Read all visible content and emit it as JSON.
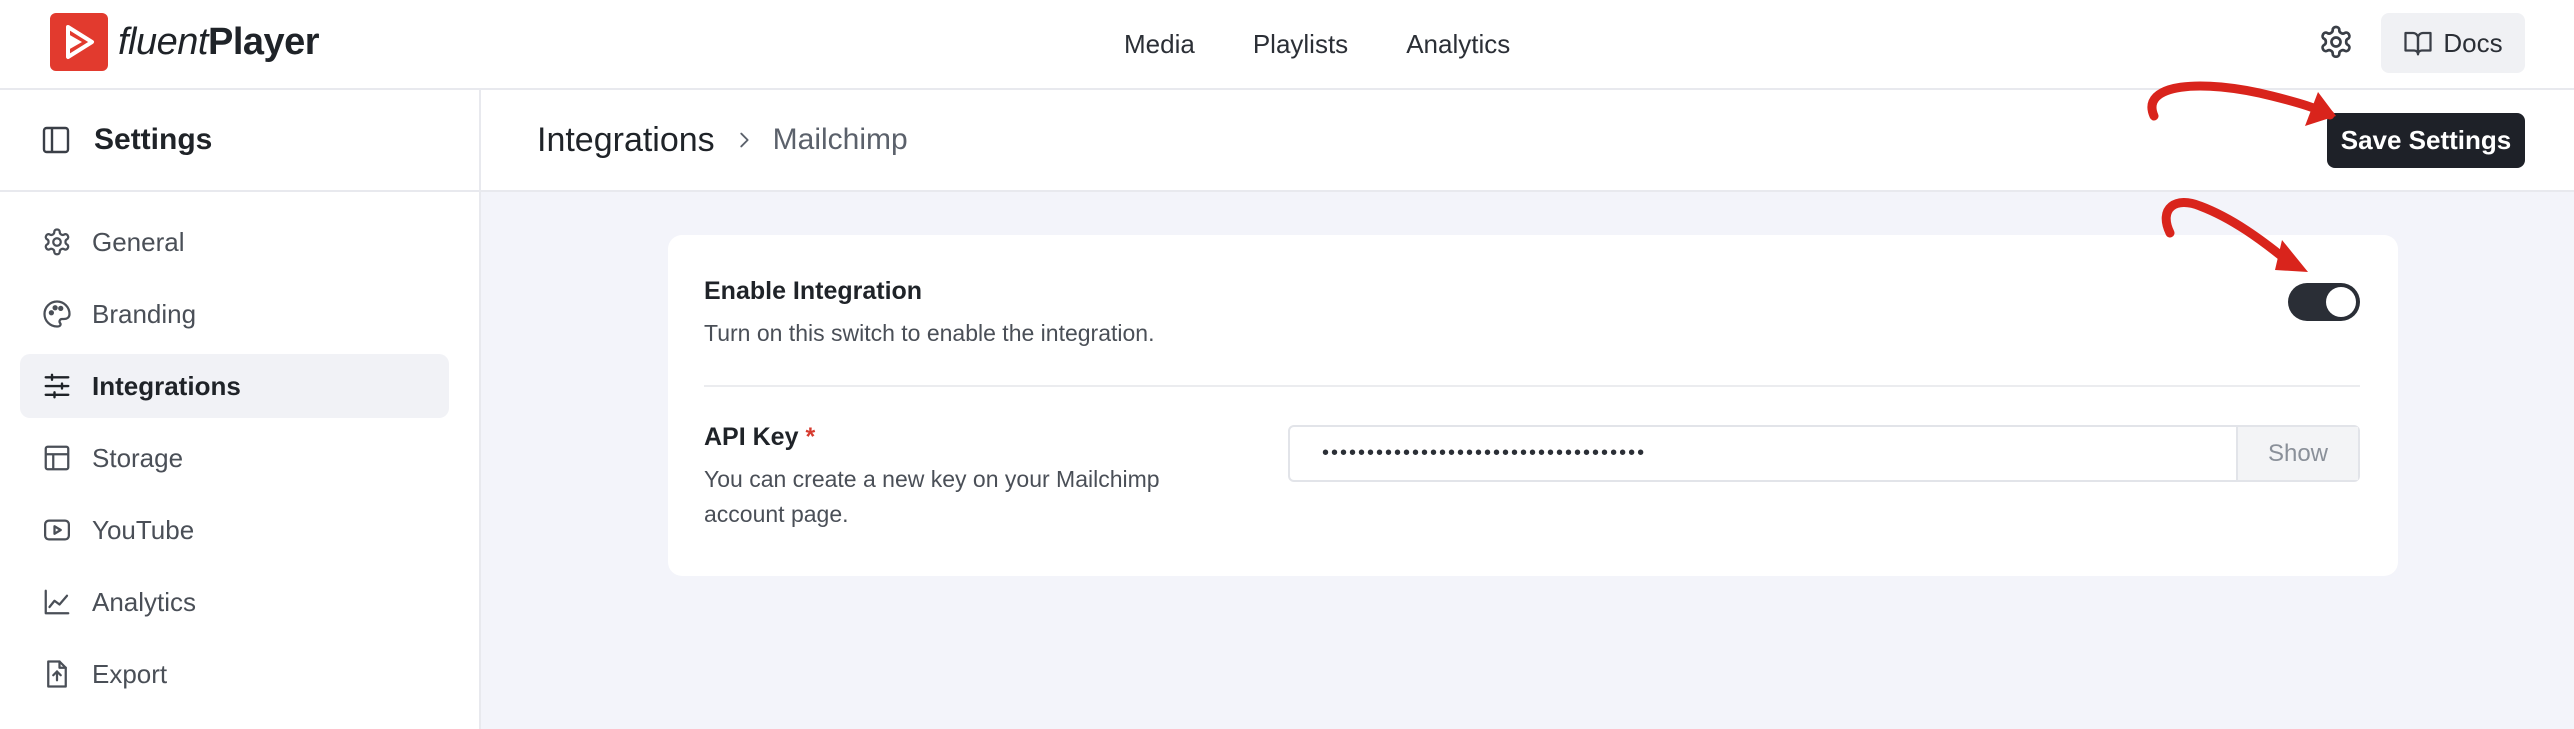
{
  "brand": {
    "name_light": "fluent",
    "name_bold": "Player",
    "color": "#e23a2e"
  },
  "topnav": {
    "items": [
      "Media",
      "Playlists",
      "Analytics"
    ]
  },
  "header_actions": {
    "docs_label": "Docs"
  },
  "sidebar": {
    "title": "Settings",
    "items": [
      {
        "label": "General",
        "icon": "gear-icon"
      },
      {
        "label": "Branding",
        "icon": "palette-icon"
      },
      {
        "label": "Integrations",
        "icon": "sliders-icon",
        "active": true
      },
      {
        "label": "Storage",
        "icon": "layout-icon"
      },
      {
        "label": "YouTube",
        "icon": "play-square-icon"
      },
      {
        "label": "Analytics",
        "icon": "trend-chart-icon"
      },
      {
        "label": "Export",
        "icon": "export-file-icon"
      }
    ]
  },
  "breadcrumb": {
    "root": "Integrations",
    "current": "Mailchimp"
  },
  "save_label": "Save Settings",
  "integration": {
    "enable_label": "Enable Integration",
    "enable_desc": "Turn on this switch to enable the integration.",
    "enabled": true,
    "api_key_label": "API Key",
    "required_mark": "*",
    "api_key_desc_1": "You can create a new key on your Mailchimp",
    "api_key_desc_2": "account page.",
    "api_key_masked": "••••••••••••••••••••••••••••••••••••",
    "show_label": "Show"
  },
  "colors": {
    "annotation_arrow": "#d9241c",
    "dark_button": "#1e2128",
    "page_bg": "#f3f4fa"
  }
}
